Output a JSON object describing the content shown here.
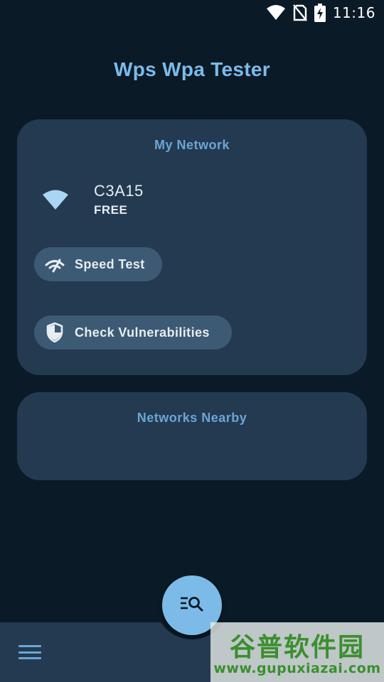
{
  "status_bar": {
    "time": "11:16",
    "icons": [
      "wifi-icon",
      "no-sim-icon",
      "battery-charging-icon"
    ]
  },
  "app": {
    "title": "Wps Wpa Tester"
  },
  "my_network": {
    "title": "My Network",
    "ssid": "C3A15",
    "security": "FREE",
    "icon": "wifi-icon",
    "actions": [
      {
        "label": "Speed Test",
        "icon": "speed-test-icon"
      },
      {
        "label": "Check Vulnerabilities",
        "icon": "shield-icon"
      }
    ]
  },
  "networks_nearby": {
    "title": "Networks Nearby"
  },
  "bottom_bar": {
    "menu_icon": "menu-icon",
    "fab_icon": "search-list-icon"
  },
  "watermark": {
    "logo": "谷普软件园",
    "url": "www.gupuxiazai.com"
  },
  "colors": {
    "background": "#0a1a27",
    "card": "#243a50",
    "chip": "#3c5a73",
    "accent": "#7cbbe8",
    "card_title": "#6aa6d6",
    "text": "#e6edf3",
    "watermark": "#3a8f2e"
  }
}
